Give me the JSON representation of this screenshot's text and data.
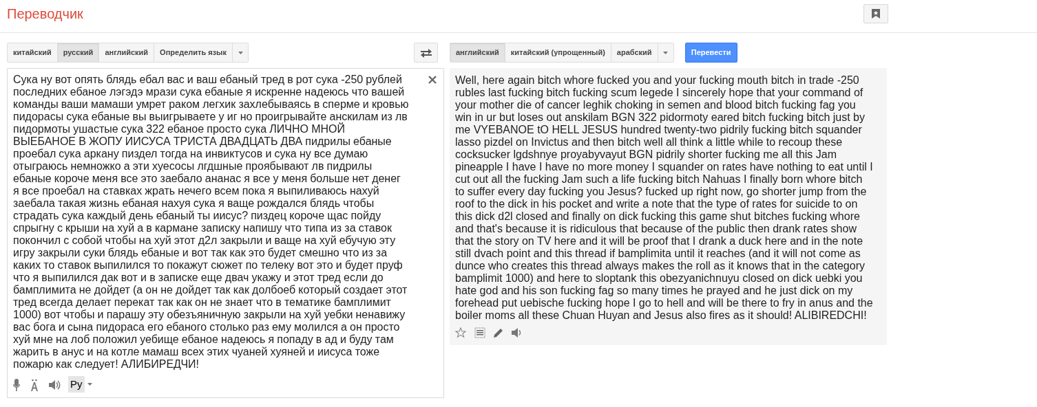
{
  "app_title": "Переводчик",
  "source_languages": [
    {
      "label": "китайский",
      "selected": false
    },
    {
      "label": "русский",
      "selected": true
    },
    {
      "label": "английский",
      "selected": false
    },
    {
      "label": "Определить язык",
      "selected": false
    }
  ],
  "target_languages": [
    {
      "label": "английский",
      "selected": true
    },
    {
      "label": "китайский (упрощенный)",
      "selected": false
    },
    {
      "label": "арабский",
      "selected": false
    }
  ],
  "translate_button": "Перевести",
  "source_text": "Сука ну вот опять блядь ебал вас и ваш ебаный тред в рот сука -250 рублей последних ебаное лэгэдэ мрази сука ебаные я искренне надеюсь что вашей команды ваши мамаши умрет раком легхик захлебываясь в сперме и кровью пидорасы сука ебаные вы выигрываете у иг но проигрывайте анскилам из лв пидормоты ушастые сука 322 ебаное просто сука ЛИЧНО МНОЙ ВЫЕБАНОЕ В ЖОПУ ИИСУСА ТРИСТА ДВАДЦАТЬ ДВА пидрилы ебаные проебал сука аркану пиздел тогда на инвиктусов и сука ну все думаю отыграюсь немножко а эти хуесосы лгдшные проябывают лв пидрилы ебаные короче меня все это заебало ананас я все у меня больше нет денег я все проебал на ставках жрать нечего всем пока я выпиливаюсь нахуй заебала такая жизнь ебаная нахуя сука я ваще рождался блядь чтобы страдать сука каждый день ебаный ты иисус? пиздец короче щас пойду спрыгну с крыши на хуй а в кармане записку напишу что типа из за ставок покончил с собой чтобы на хуй этот д2л закрыли и ваще на хуй ебучую эту игру закрыли суки блядь ебаные и вот так как это будет смешно что из за каких то ставок выпилился то покажут сюжет по телеку вот это и будет пруф что я выпилился дак вот и в записке еще двач укажу и этот тред если до бамплимита не дойдет (а он не дойдет так как долбоеб который создает этот тред всегда делает перекат так как он не знает что в тематике бамплимит 1000) вот чтобы и парашу эту обезъяничную закрыли на хуй уебки ненавижу вас бога и сына пидораса его ебаного столько раз ему молился а он просто хуй мне на лоб положил уебище ебаное надеюсь я попаду в ад и буду там жарить в анус и на котле мамаш всех этих чуаней хуяней и иисуса тоже пожарю как следует! АЛИБИРЕДЧИ!",
  "input_language_badge": "Ру",
  "translation": "Well, here again bitch whore fucked you and your fucking mouth bitch in trade -250 rubles last fucking bitch fucking scum legede I sincerely hope that your command of your mother die of cancer leghik choking in semen and blood bitch fucking fag you win in ur but loses out anskilam BGN 322 pidormoty eared bitch fucking bitch just by me VYEBANOE tO HELL JESUS hundred twenty-two pidrily fucking bitch squander lasso pizdel on Invictus and then bitch well all think a little while to recoup these cocksucker lgdshnye proyabyvayut BGN pidrily shorter fucking me all this Jam pineapple I have I have no more money I squander on rates have nothing to eat until I cut out all the fucking Jam such a life fucking bitch Nahuas I finally born whore bitch to suffer every day fucking you Jesus? fucked up right now, go shorter jump from the roof to the dick in his pocket and write a note that the type of rates for suicide to on this dick d2l closed and finally on dick fucking this game shut bitches fucking whore and that's because it is ridiculous that because of the public then drank rates show that the story on TV here and it will be proof that I drank a duck here and in the note still dvach point and this thread if bamplimita until it reaches (and it will not come as dunce who creates this thread always makes the roll as it knows that in the category bamplimit 1000) and here to sloptank this obezyanichnuyu closed on dick uebki you hate god and his son fucking fag so many times he prayed and he just dick on my forehead put uebische fucking hope I go to hell and will be there to fry in anus and the boiler moms all these Chuan Huyan and Jesus also fires as it should! ALIBIREDCHI!"
}
